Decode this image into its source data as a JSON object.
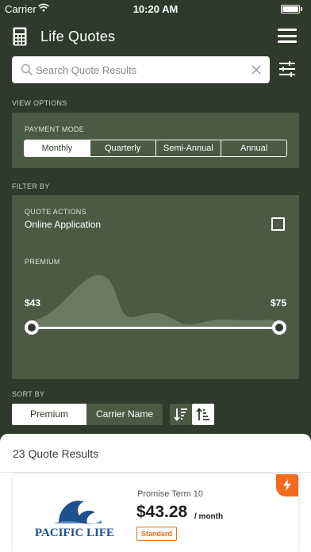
{
  "status_bar": {
    "carrier": "Carrier",
    "time": "10:20 AM"
  },
  "nav": {
    "title": "Life Quotes"
  },
  "search": {
    "placeholder": "Search Quote Results"
  },
  "view_options": {
    "section_label": "VIEW OPTIONS",
    "payment_mode_label": "PAYMENT MODE",
    "modes": [
      {
        "label": "Monthly",
        "active": true
      },
      {
        "label": "Quarterly",
        "active": false
      },
      {
        "label": "Semi-Annual",
        "active": false
      },
      {
        "label": "Annual",
        "active": false
      }
    ]
  },
  "filter": {
    "section_label": "FILTER BY",
    "quote_actions_label": "QUOTE ACTIONS",
    "online_application_label": "Online Application",
    "online_application_checked": false,
    "premium_label": "PREMIUM",
    "premium_min": "$43",
    "premium_max": "$75"
  },
  "sort": {
    "section_label": "SORT BY",
    "premium_label": "Premium",
    "carrier_label": "Carrier Name",
    "active": "Premium",
    "order": "ascending"
  },
  "results": {
    "count_text": "23 Quote Results",
    "cards": [
      {
        "carrier": "PACIFIC LIFE",
        "plan": "Promise Term 10",
        "price": "$43.28",
        "per": "/ month",
        "badge": "Standard"
      }
    ]
  },
  "colors": {
    "background": "#2f3b2a",
    "panel": "#4a5a43",
    "accent_orange": "#f26a1b",
    "carrier_blue": "#1f4f8f"
  },
  "icons": {
    "nav_left": "calculator-icon",
    "nav_right": "hamburger-menu-icon",
    "search": "search-icon",
    "clear": "close-icon",
    "filters": "sliders-icon",
    "card_corner": "lightning-bolt-icon"
  }
}
